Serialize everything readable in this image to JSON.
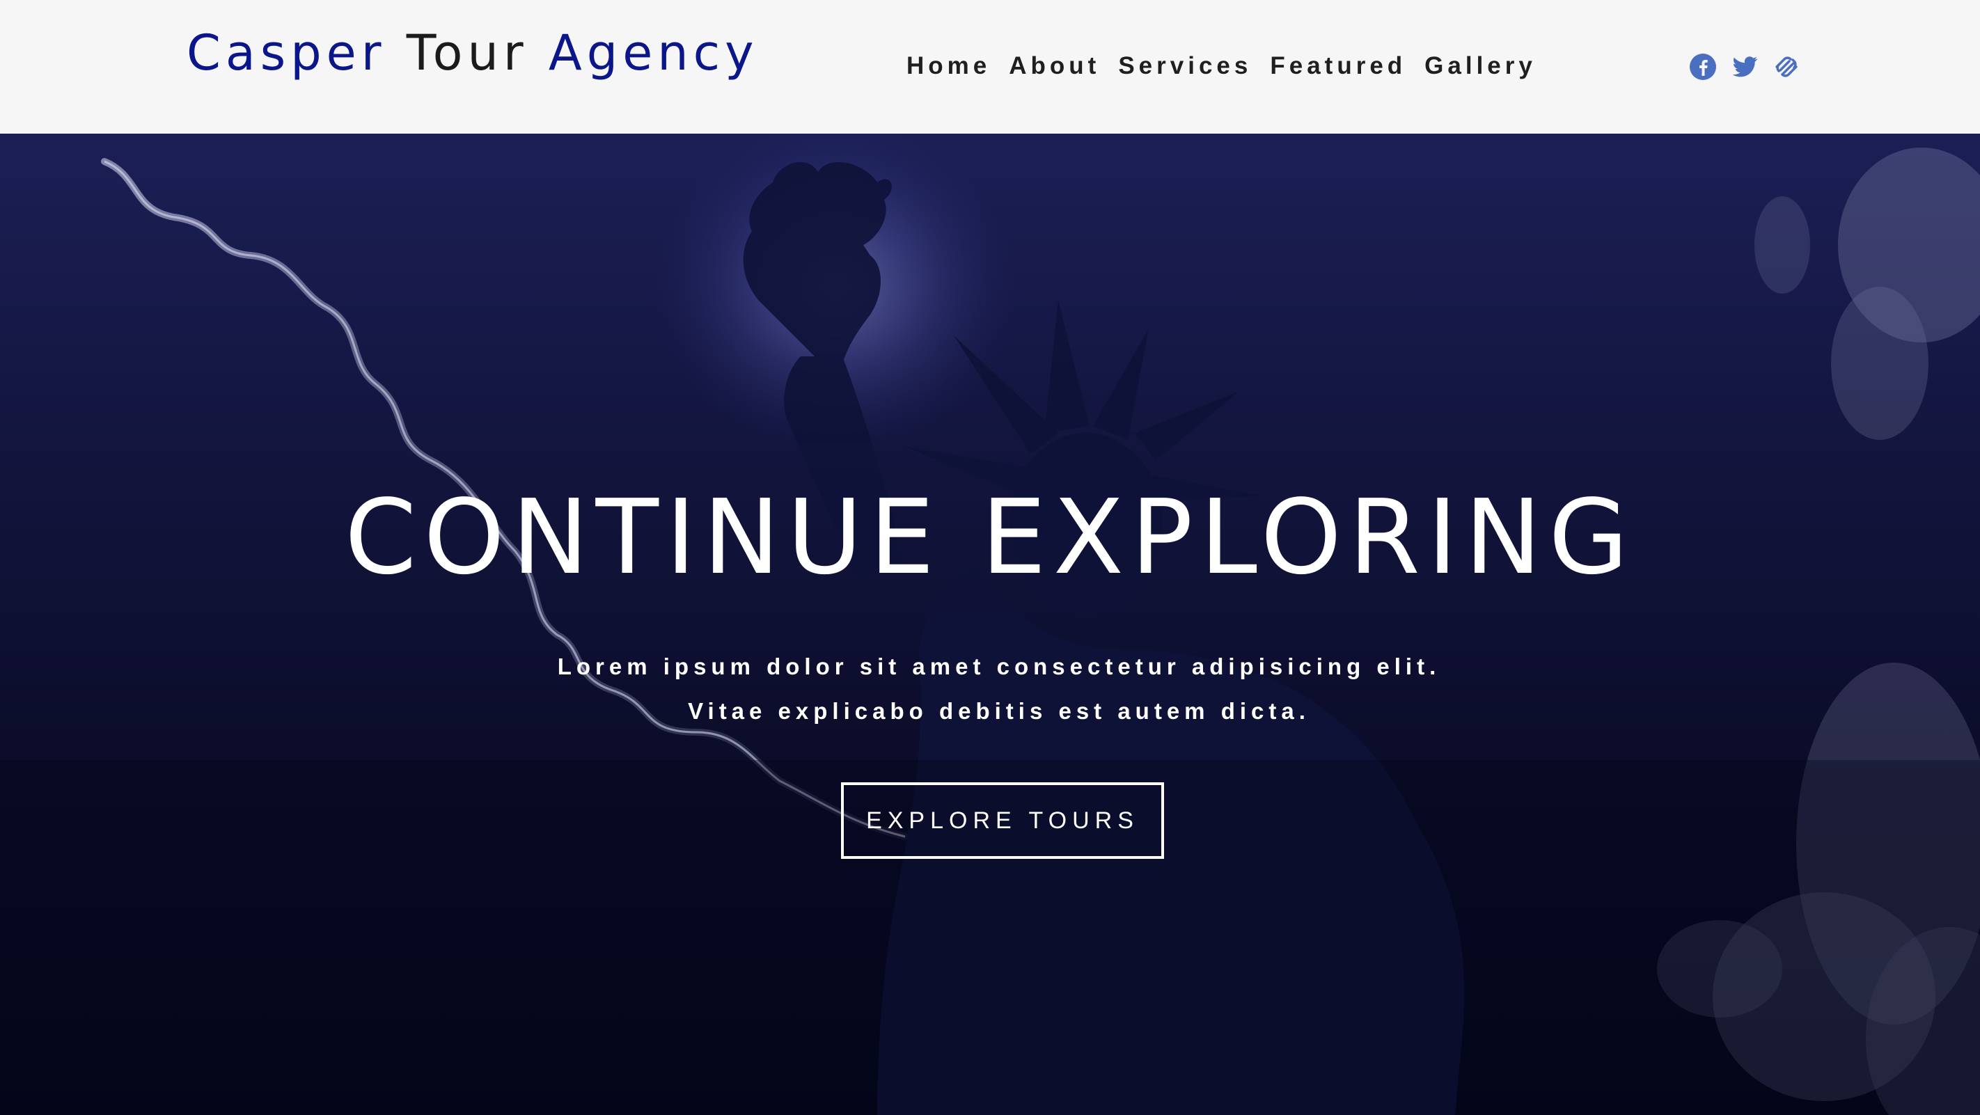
{
  "brand": {
    "part1": "Casper",
    "part2": "Tour",
    "part3": "Agency"
  },
  "nav": {
    "items": [
      {
        "label": "Home"
      },
      {
        "label": "About"
      },
      {
        "label": "Services"
      },
      {
        "label": "Featured"
      },
      {
        "label": "Gallery"
      }
    ]
  },
  "social": {
    "icons": [
      "facebook-icon",
      "twitter-icon",
      "squarespace-icon"
    ],
    "color": "#4a6fc0"
  },
  "hero": {
    "title": "CONTINUE EXPLORING",
    "subtitle": "Lorem ipsum dolor sit amet consectetur adipisicing elit. Vitae explicabo debitis est autem dicta.",
    "button_label": "EXPLORE TOURS"
  },
  "colors": {
    "brand_accent": "#0b168a",
    "navbar_bg": "#f6f6f6",
    "hero_top": "#1b1f55",
    "hero_bottom": "#05061a"
  }
}
